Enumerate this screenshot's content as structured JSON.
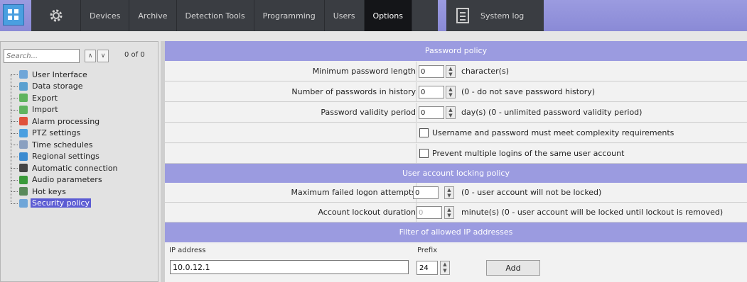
{
  "toolbar": {
    "tabs": [
      "Devices",
      "Archive",
      "Detection Tools",
      "Programming",
      "Users",
      "Options"
    ],
    "active_tab": "Options",
    "system_log": "System log",
    "home_icon": "grid-icon",
    "settings_icon": "gear-icon",
    "log_icon": "document-icon"
  },
  "search": {
    "placeholder": "Search...",
    "count": "0 of 0"
  },
  "tree": {
    "items": [
      {
        "label": "User Interface",
        "icon": "monitor-icon",
        "color": "#6fa6d8"
      },
      {
        "label": "Data storage",
        "icon": "database-icon",
        "color": "#5aa0d0"
      },
      {
        "label": "Export",
        "icon": "export-icon",
        "color": "#5fb35f"
      },
      {
        "label": "Import",
        "icon": "import-icon",
        "color": "#5fb35f"
      },
      {
        "label": "Alarm processing",
        "icon": "alarm-icon",
        "color": "#e0503a"
      },
      {
        "label": "PTZ settings",
        "icon": "ptz-icon",
        "color": "#4a9fe0"
      },
      {
        "label": "Time schedules",
        "icon": "clock-icon",
        "color": "#8aa0c0"
      },
      {
        "label": "Regional settings",
        "icon": "globe-icon",
        "color": "#3a8ad0"
      },
      {
        "label": "Automatic connection",
        "icon": "connection-icon",
        "color": "#444444"
      },
      {
        "label": "Audio parameters",
        "icon": "audio-icon",
        "color": "#3a9a3a"
      },
      {
        "label": "Hot keys",
        "icon": "keyboard-icon",
        "color": "#5a8a5a"
      },
      {
        "label": "Security policy",
        "icon": "shield-icon",
        "color": "#6fa6d8"
      }
    ],
    "selected": "Security policy"
  },
  "sections": {
    "password_policy": "Password policy",
    "locking_policy": "User account locking policy",
    "ip_filter": "Filter of allowed IP addresses"
  },
  "password_policy": {
    "min_length": {
      "label": "Minimum password length",
      "value": "0",
      "hint": "character(s)"
    },
    "history": {
      "label": "Number of passwords in history",
      "value": "0",
      "hint": "(0 - do not save password history)"
    },
    "validity": {
      "label": "Password validity period",
      "value": "0",
      "hint": "day(s) (0 - unlimited password validity period)"
    },
    "complexity": {
      "label": "Username and password must meet complexity requirements",
      "checked": false
    },
    "multiple_logins": {
      "label": "Prevent multiple logins of the same user account",
      "checked": false
    }
  },
  "locking_policy": {
    "max_attempts": {
      "label": "Maximum failed logon attempts",
      "value": "0",
      "hint": "(0 - user account will not be locked)"
    },
    "lockout_duration": {
      "label": "Account lockout duration",
      "value": "0",
      "hint": "minute(s) (0 - user account will be locked until lockout is removed)"
    }
  },
  "ip_filter": {
    "ip_label": "IP address",
    "prefix_label": "Prefix",
    "ip_value": "10.0.12.1",
    "prefix_value": "24",
    "add_label": "Add"
  },
  "colors": {
    "accent": "#9b9be0",
    "dark_toolbar": "#3a3d42",
    "selected": "#5c5cd3"
  }
}
